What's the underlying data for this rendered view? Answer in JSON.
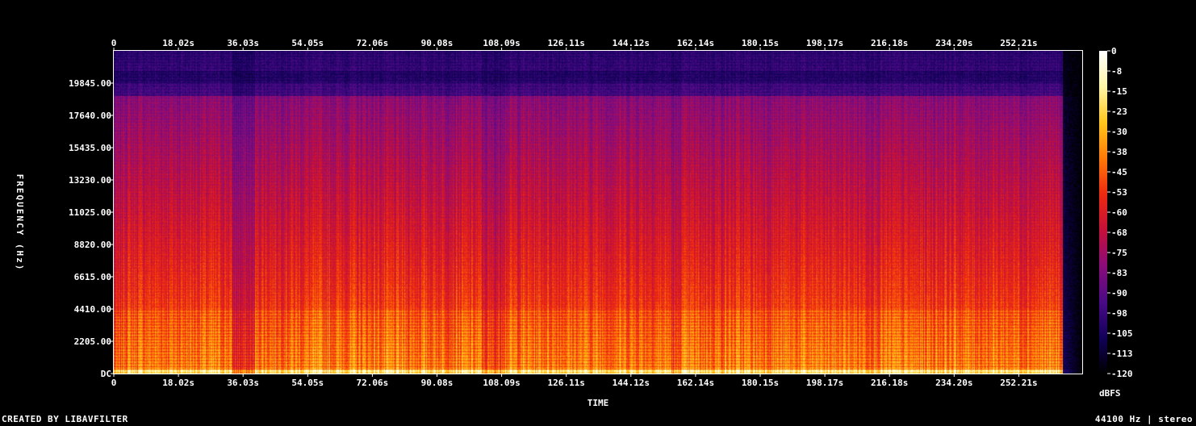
{
  "chart_data": {
    "type": "heatmap",
    "title": "",
    "xlabel": "TIME",
    "ylabel": "FREQUENCY (Hz)",
    "x_ticks": [
      "0",
      "18.02s",
      "36.03s",
      "54.05s",
      "72.06s",
      "90.08s",
      "108.09s",
      "126.11s",
      "144.12s",
      "162.14s",
      "180.15s",
      "198.17s",
      "216.18s",
      "234.20s",
      "252.21s"
    ],
    "y_ticks": [
      "DC",
      "2205.00",
      "4410.00",
      "6615.00",
      "8820.00",
      "11025.00",
      "13230.00",
      "15435.00",
      "17640.00",
      "19845.00"
    ],
    "colorbar": {
      "label": "dBFS",
      "ticks": [
        "0",
        "-8",
        "-15",
        "-23",
        "-30",
        "-38",
        "-45",
        "-53",
        "-60",
        "-68",
        "-75",
        "-83",
        "-90",
        "-98",
        "-105",
        "-113",
        "-120"
      ],
      "range": [
        -120,
        0
      ],
      "colormap": [
        "#000000",
        "#12005a",
        "#4a0a86",
        "#8a0c7a",
        "#c4103a",
        "#ee2a10",
        "#ff7a08",
        "#ffc61c",
        "#fff6a8",
        "#ffffff"
      ]
    },
    "grid": false
  },
  "footer": {
    "left": "CREATED BY LIBAVFILTER",
    "right": "44100 Hz | stereo"
  }
}
